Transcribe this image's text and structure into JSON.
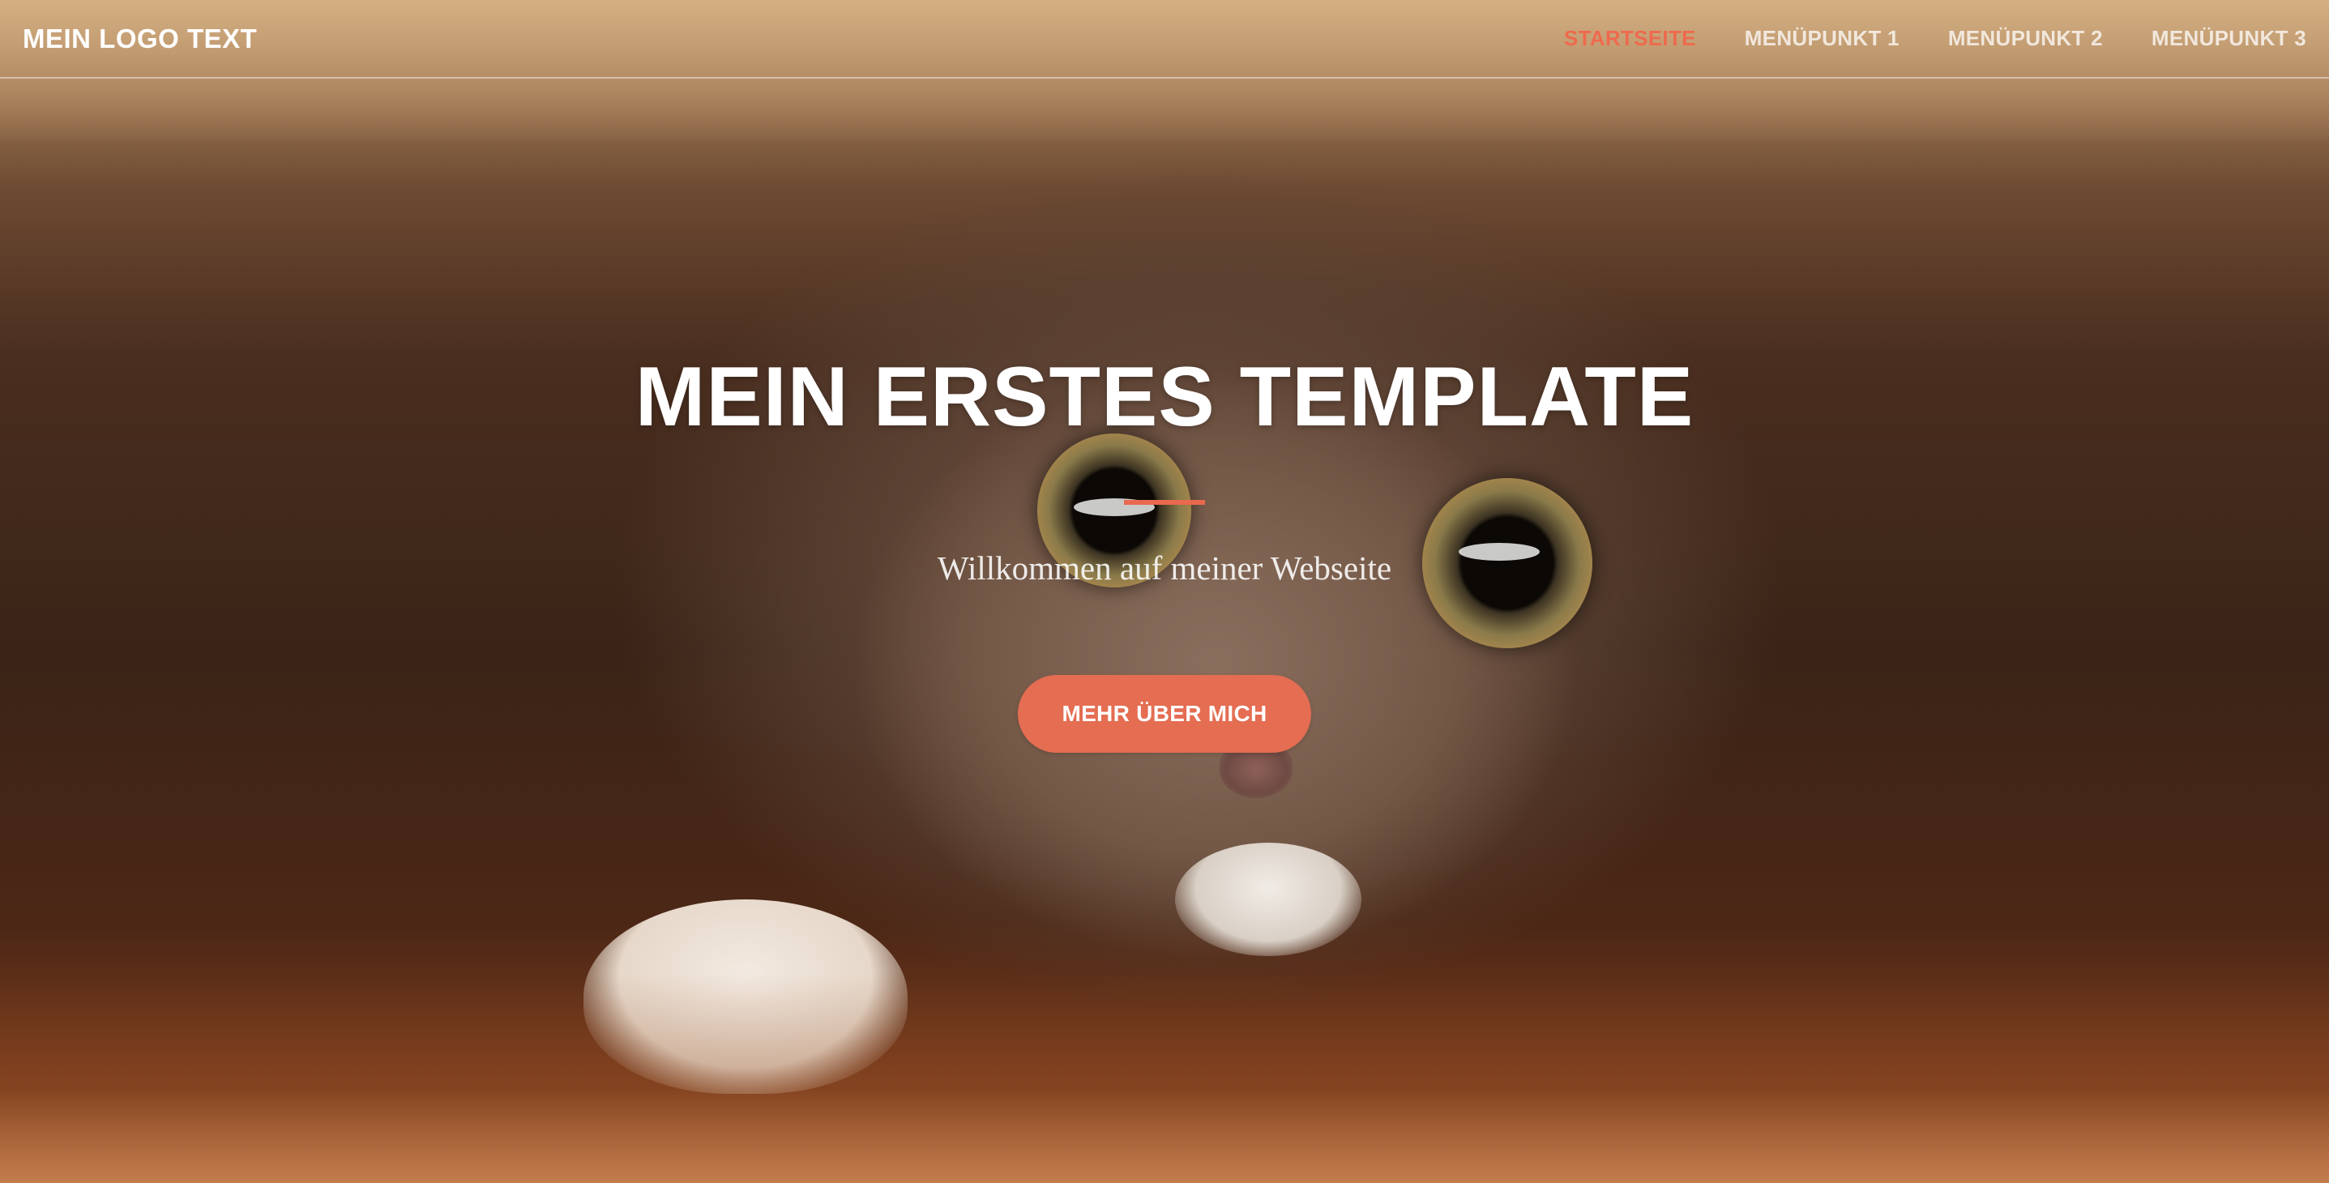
{
  "header": {
    "logo_text": "MEIN LOGO TEXT",
    "nav": [
      {
        "label": "STARTSEITE",
        "active": true
      },
      {
        "label": "MENÜPUNKT 1",
        "active": false
      },
      {
        "label": "MENÜPUNKT 2",
        "active": false
      },
      {
        "label": "MENÜPUNKT 3",
        "active": false
      }
    ]
  },
  "hero": {
    "title": "MEIN ERSTES TEMPLATE",
    "subtitle": "Willkommen auf meiner Webseite",
    "cta_label": "MEHR ÜBER MICH"
  },
  "colors": {
    "accent": "#e46d52",
    "nav_active": "#ee6a4e",
    "text": "#ffffff"
  }
}
